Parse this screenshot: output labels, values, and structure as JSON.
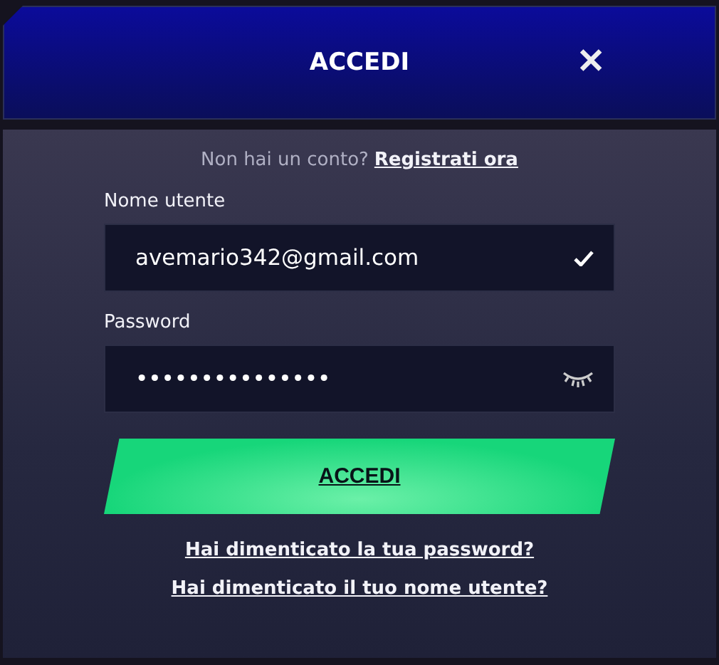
{
  "header": {
    "title": "ACCEDI",
    "close": "✕"
  },
  "signup": {
    "prompt": "Non hai un conto?",
    "link": "Registrati ora"
  },
  "username": {
    "label": "Nome utente",
    "value": "avemario342@gmail.com",
    "valid": true
  },
  "password": {
    "label": "Password",
    "value": "•••••••••••••••",
    "visible": false
  },
  "submit": "ACCEDI",
  "links": [
    "Hai dimenticato la tua password?",
    "Hai dimenticato il tuo nome utente?"
  ]
}
